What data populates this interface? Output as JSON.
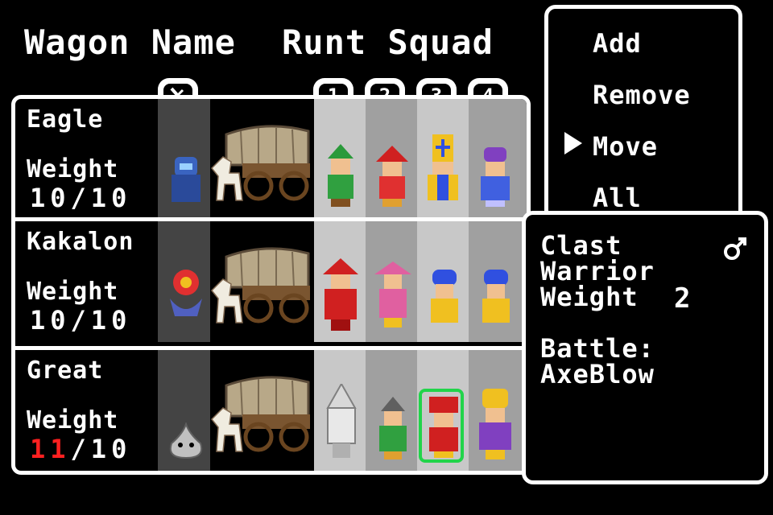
{
  "header": {
    "label": "Wagon Name",
    "value": "Runt Squad"
  },
  "slot_tabs": [
    "1",
    "2",
    "3",
    "4"
  ],
  "monster_tab_icon": "sword-icon",
  "wagons": [
    {
      "name": "Eagle",
      "weight_label": "Weight",
      "weight_current": "10",
      "weight_max": "10",
      "over_limit": false
    },
    {
      "name": "Kakalon",
      "weight_label": "Weight",
      "weight_current": "10",
      "weight_max": "10",
      "over_limit": false
    },
    {
      "name": "Great",
      "weight_label": "Weight",
      "weight_current": "11",
      "weight_max": "10",
      "over_limit": true
    }
  ],
  "weight_separator": "/",
  "menu": {
    "items": [
      "Add",
      "Remove",
      "Move",
      "All"
    ],
    "selected_index": 2
  },
  "info": {
    "name": "Clast",
    "class": "Warrior",
    "weight_label": "Weight",
    "weight_value": "2",
    "gender_icon": "male-symbol-icon",
    "battle_label": "Battle:",
    "battle_value": "AxeBlow"
  },
  "colors": {
    "selection": "#21d44a",
    "over_limit": "#ff2020"
  }
}
